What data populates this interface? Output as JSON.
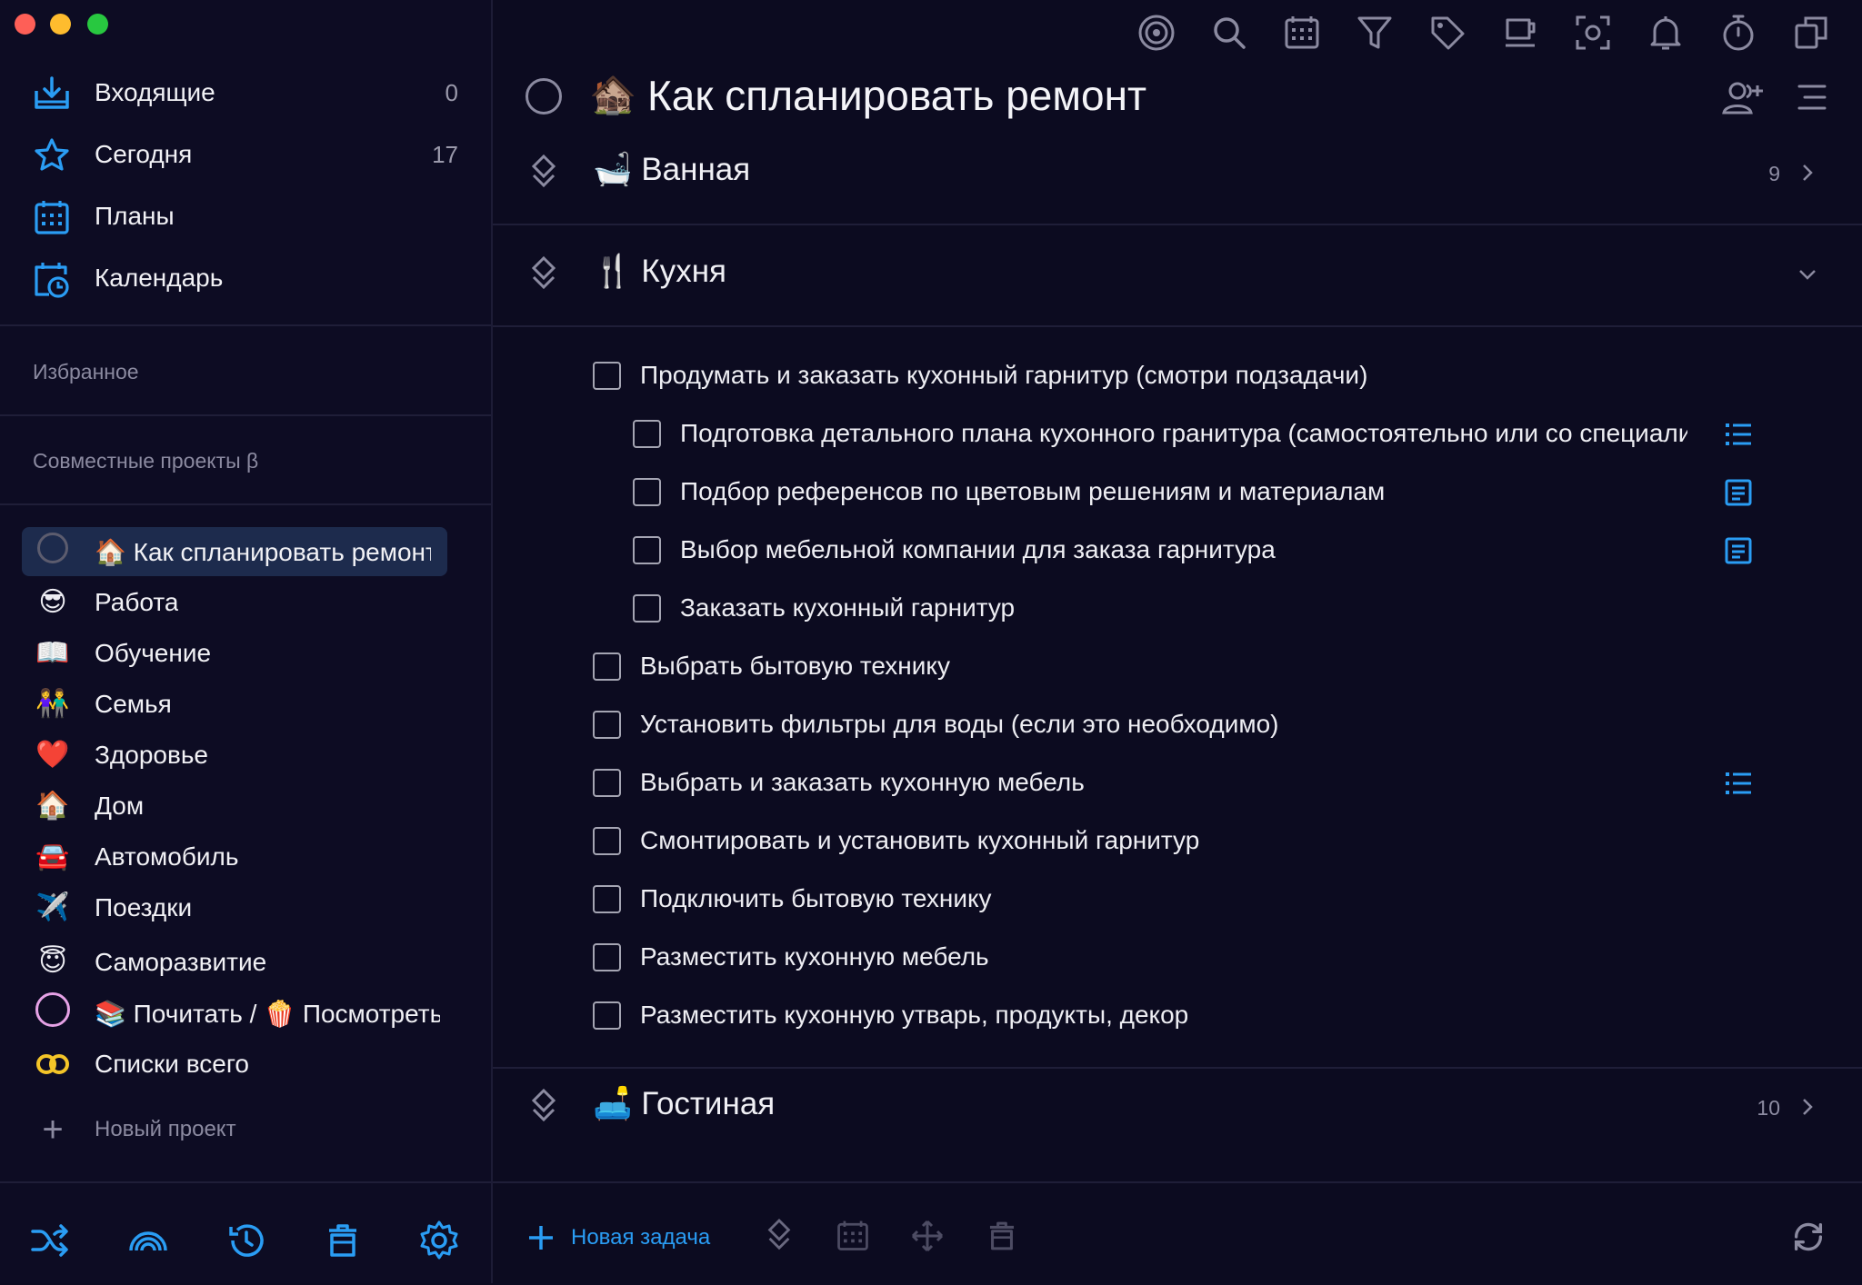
{
  "colors": {
    "accent": "#2a9df4",
    "sidebar_bg": "#0d0c23",
    "main_bg": "#0c0b20",
    "active_project_bg": "#1d2b4d"
  },
  "sidebar": {
    "nav": [
      {
        "label": "Входящие",
        "count": "0",
        "icon": "inbox-icon"
      },
      {
        "label": "Сегодня",
        "count": "17",
        "icon": "star-icon"
      },
      {
        "label": "Планы",
        "count": "",
        "icon": "calendar-grid-icon"
      },
      {
        "label": "Календарь",
        "count": "",
        "icon": "calendar-clock-icon"
      }
    ],
    "favorites_title": "Избранное",
    "shared_title": "Совместные проекты β",
    "projects": [
      {
        "emoji": "",
        "label": "🏠 Как спланировать ремонт"
      },
      {
        "emoji": "😎",
        "label": "Работа"
      },
      {
        "emoji": "📖",
        "label": "Обучение"
      },
      {
        "emoji": "👫",
        "label": "Семья"
      },
      {
        "emoji": "❤️",
        "label": "Здоровье"
      },
      {
        "emoji": "🏠",
        "label": "Дом"
      },
      {
        "emoji": "🚘",
        "label": "Автомобиль"
      },
      {
        "emoji": "✈️",
        "label": "Поездки"
      },
      {
        "emoji": "😇",
        "label": "Саморазвитие"
      },
      {
        "emoji": "",
        "label": "📚 Почитать / 🍿 Посмотреть"
      },
      {
        "emoji": "",
        "label": "Списки всего"
      }
    ],
    "new_project": "Новый проект",
    "bottom_icons": [
      "shuffle-icon",
      "rainbow-icon",
      "history-icon",
      "trash-icon",
      "settings-icon"
    ]
  },
  "topbar": {
    "icons": [
      "focus-target-icon",
      "search-icon",
      "calendar-icon",
      "filter-icon",
      "tag-icon",
      "coffee-icon",
      "capture-icon",
      "bell-icon",
      "timer-icon",
      "windows-icon"
    ]
  },
  "project": {
    "emoji": "🏚️",
    "title": "Как спланировать ремонт"
  },
  "sections": [
    {
      "emoji": "🛁",
      "name": "Ванная",
      "count": "9",
      "expanded": false
    },
    {
      "emoji": "🍴",
      "name": "Кухня",
      "count": "",
      "expanded": true
    },
    {
      "emoji": "🛋️",
      "name": "Гостиная",
      "count": "10",
      "expanded": false
    }
  ],
  "kitchen_tasks": [
    {
      "text": "Продумать и заказать кухонный гарнитур (смотри подзадачи)",
      "indent": 0,
      "icon": ""
    },
    {
      "text": "Подготовка детального плана кухонного гранитура (самостоятельно или со специалистом)",
      "indent": 1,
      "icon": "checklist-icon"
    },
    {
      "text": "Подбор референсов по цветовым решениям и материалам",
      "indent": 1,
      "icon": "note-icon"
    },
    {
      "text": "Выбор мебельной компании для заказа гарнитура",
      "indent": 1,
      "icon": "note-icon"
    },
    {
      "text": "Заказать кухонный гарнитур",
      "indent": 1,
      "icon": ""
    },
    {
      "text": "Выбрать бытовую технику",
      "indent": 0,
      "icon": ""
    },
    {
      "text": "Установить фильтры для воды (если это необходимо)",
      "indent": 0,
      "icon": ""
    },
    {
      "text": "Выбрать и заказать кухонную мебель",
      "indent": 0,
      "icon": "checklist-icon"
    },
    {
      "text": "Смонтировать и установить кухонный гарнитур",
      "indent": 0,
      "icon": ""
    },
    {
      "text": "Подключить бытовую технику",
      "indent": 0,
      "icon": ""
    },
    {
      "text": "Разместить кухонную мебель",
      "indent": 0,
      "icon": ""
    },
    {
      "text": "Разместить кухонную утварь, продукты, декор",
      "indent": 0,
      "icon": ""
    }
  ],
  "bottombar": {
    "new_task": "Новая задача"
  }
}
